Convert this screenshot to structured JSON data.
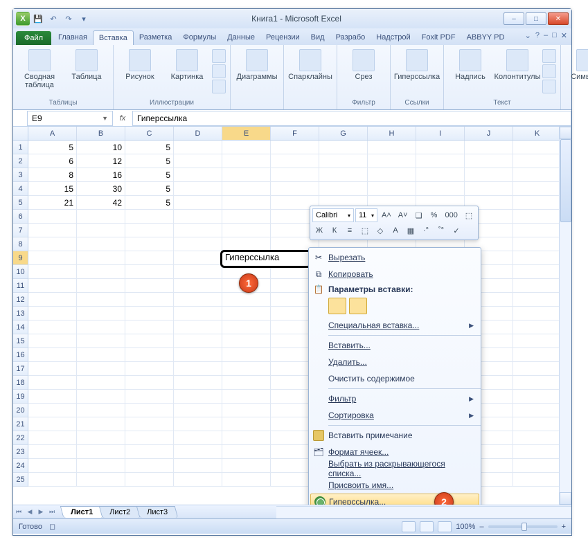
{
  "title": "Книга1  -  Microsoft Excel",
  "qat": {
    "save_icon": "save",
    "undo_icon": "undo",
    "redo_icon": "redo"
  },
  "tabs": {
    "file": "Файл",
    "items": [
      "Главная",
      "Вставка",
      "Разметка",
      "Формулы",
      "Данные",
      "Рецензии",
      "Вид",
      "Разрабо",
      "Надстрой",
      "Foxit PDF",
      "ABBYY PD"
    ],
    "active_index": 1
  },
  "ribbon": {
    "groups": [
      {
        "label": "Таблицы",
        "buttons": [
          {
            "l": "Сводная\nтаблица"
          },
          {
            "l": "Таблица"
          }
        ]
      },
      {
        "label": "Иллюстрации",
        "buttons": [
          {
            "l": "Рисунок"
          },
          {
            "l": "Картинка"
          }
        ],
        "smallcol": true
      },
      {
        "label": "",
        "buttons": [
          {
            "l": "Диаграммы"
          }
        ]
      },
      {
        "label": "",
        "buttons": [
          {
            "l": "Спарклайны"
          }
        ]
      },
      {
        "label": "Фильтр",
        "buttons": [
          {
            "l": "Срез"
          }
        ]
      },
      {
        "label": "Ссылки",
        "buttons": [
          {
            "l": "Гиперссылка"
          }
        ]
      },
      {
        "label": "Текст",
        "buttons": [
          {
            "l": "Надпись"
          },
          {
            "l": "Колонтитулы"
          }
        ],
        "smallcol": true
      },
      {
        "label": "",
        "buttons": [
          {
            "l": "Символы"
          }
        ]
      }
    ]
  },
  "namebox": "E9",
  "fx_label": "fx",
  "formula": "Гиперссылка",
  "columns": [
    "A",
    "B",
    "C",
    "D",
    "E",
    "F",
    "G",
    "H",
    "I",
    "J",
    "K"
  ],
  "active_col_index": 4,
  "active_row_index": 8,
  "row_count": 25,
  "cells": {
    "1": {
      "A": "5",
      "B": "10",
      "C": "5"
    },
    "2": {
      "A": "6",
      "B": "12",
      "C": "5"
    },
    "3": {
      "A": "8",
      "B": "16",
      "C": "5"
    },
    "4": {
      "A": "15",
      "B": "30",
      "C": "5"
    },
    "5": {
      "A": "21",
      "B": "42",
      "C": "5"
    }
  },
  "active_cell_text": "Гиперссылка",
  "callouts": {
    "1": "1",
    "2": "2"
  },
  "mini": {
    "font": "Calibri",
    "size": "11",
    "btns_row1": [
      "A˄",
      "A˅",
      "❏",
      "%",
      "000",
      "⬚"
    ],
    "btns_row2": [
      "Ж",
      "К",
      "≡",
      "⬚",
      "◇",
      "A",
      "▦",
      "·°",
      "˚°",
      "✓"
    ]
  },
  "ctx": {
    "cut": "Вырезать",
    "copy": "Копировать",
    "paste_header": "Параметры вставки:",
    "paste_special": "Специальная вставка...",
    "insert": "Вставить...",
    "delete": "Удалить...",
    "clear": "Очистить содержимое",
    "filter": "Фильтр",
    "sort": "Сортировка",
    "comment": "Вставить примечание",
    "format": "Формат ячеек...",
    "dropdown": "Выбрать из раскрывающегося списка...",
    "name": "Присвоить имя...",
    "hyperlink": "Гиперссылка..."
  },
  "sheets": {
    "items": [
      "Лист1",
      "Лист2",
      "Лист3"
    ],
    "active": 0
  },
  "status": {
    "ready": "Готово",
    "zoom": "100%",
    "zoom_minus": "–",
    "zoom_plus": "+"
  }
}
